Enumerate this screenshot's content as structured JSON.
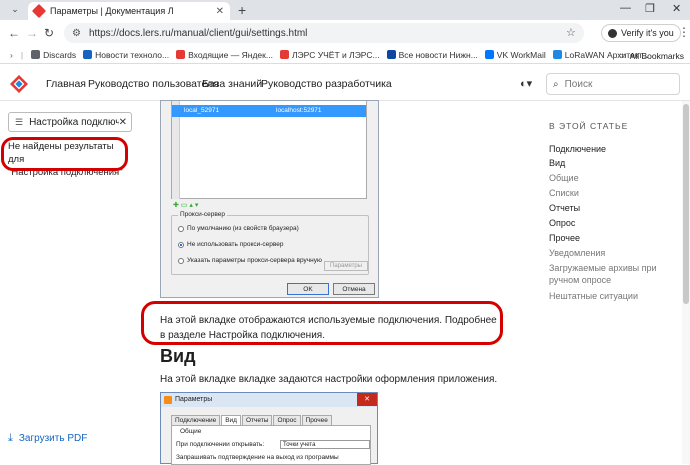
{
  "browser": {
    "tab_title": "Параметры | Документация Л",
    "url": "https://docs.lers.ru/manual/client/gui/settings.html",
    "verify_label": "Verify it's you",
    "all_bookmarks": "All Bookmarks",
    "bookmarks": [
      {
        "label": "Discards",
        "color": "#5f6368"
      },
      {
        "label": "Новости техноло...",
        "color": "#1565c0"
      },
      {
        "label": "Входящие — Яндек...",
        "color": "#e53935"
      },
      {
        "label": "ЛЭРС УЧЁТ и ЛЭРС...",
        "color": "#e53935"
      },
      {
        "label": "Все новости Нижн...",
        "color": "#0d47a1"
      },
      {
        "label": "VK WorkMail",
        "color": "#0077ff"
      },
      {
        "label": "LoRaWAN Архитект...",
        "color": "#1e88e5"
      }
    ]
  },
  "site": {
    "nav": [
      "Главная",
      "Руководство пользователя",
      "База знаний",
      "Руководство разработчика"
    ],
    "search_placeholder": "Поиск"
  },
  "sidebar": {
    "filter_value": "Настройка подключени",
    "not_found_line1": "Не найдены результаты для",
    "not_found_line2": "\"Настройка подключения\"",
    "pdf_label": "Загрузить PDF"
  },
  "screenshot1": {
    "rows": [
      {
        "name": "local_52971",
        "addr": "localhost:52971"
      }
    ],
    "proxy_legend": "Прокси-сервер",
    "radio": [
      "По умолчанию (из свойств браузера)",
      "Не использовать прокси-сервер",
      "Указать параметры прокси-сервера вручную"
    ],
    "params_button": "Параметры",
    "ok": "OK",
    "cancel": "Отмена"
  },
  "content": {
    "para1": "На этой вкладке отображаются используемые подключения. Подробнее в разделе Настройка подключения.",
    "h2": "Вид",
    "para2": "На этой вкладке вкладке задаются настройки оформления приложения."
  },
  "screenshot2": {
    "title": "Параметры",
    "tabs": [
      "Подключение",
      "Вид",
      "Отчеты",
      "Опрос",
      "Прочее"
    ],
    "group": "Общие",
    "label1": "При подключении открывать:",
    "value1": "Точки учета",
    "label2": "Запрашивать подтверждение на выход из программы"
  },
  "toc": {
    "heading": "В ЭТОЙ СТАТЬЕ",
    "items": [
      {
        "label": "Подключение",
        "sub": false
      },
      {
        "label": "Вид",
        "sub": false
      },
      {
        "label": "Общие",
        "sub": true
      },
      {
        "label": "Списки",
        "sub": true
      },
      {
        "label": "Отчеты",
        "sub": false
      },
      {
        "label": "Опрос",
        "sub": false
      },
      {
        "label": "Прочее",
        "sub": false
      },
      {
        "label": "Уведомления",
        "sub": true
      },
      {
        "label": "Загружаемые архивы при ручном опросе",
        "sub": true
      },
      {
        "label": "Нештатные ситуации",
        "sub": true
      }
    ]
  }
}
